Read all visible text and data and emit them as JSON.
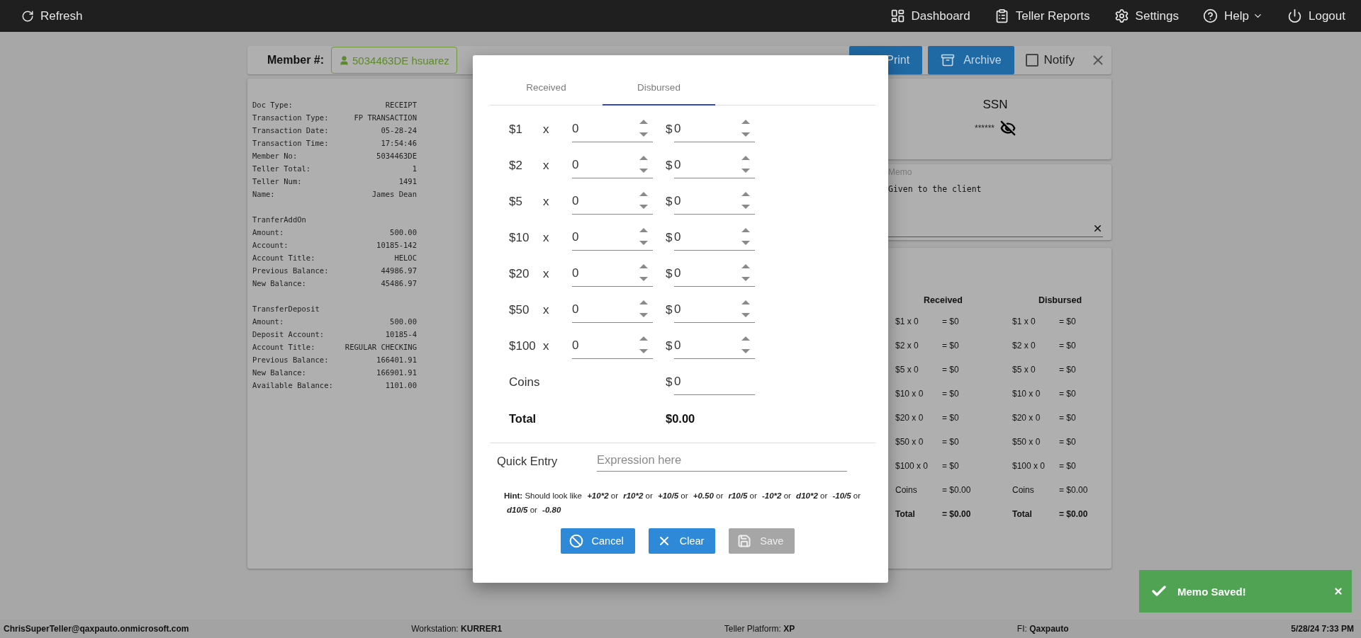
{
  "top_bar": {
    "left": [
      {
        "label": "Refresh"
      }
    ],
    "right": [
      {
        "label": "Dashboard",
        "has_menu": false
      },
      {
        "label": "Teller Reports",
        "has_menu": false
      },
      {
        "label": "Settings",
        "has_menu": false
      },
      {
        "label": "Help",
        "has_menu": true
      },
      {
        "label": "Logout",
        "has_menu": false
      }
    ]
  },
  "member": {
    "label": "Member #:",
    "value": "5034463DE hsuarez"
  },
  "actions": {
    "buttons": [
      {
        "label": "Print"
      },
      {
        "label": "Archive"
      }
    ],
    "notify": {
      "label": "Notify",
      "checked": false
    }
  },
  "receipt": {
    "sections": [
      {
        "lines": [
          {
            "label": "Doc Type:",
            "value": "RECEIPT"
          },
          {
            "label": "Transaction Type:",
            "value": "FP TRANSACTION"
          },
          {
            "label": "Transaction Date:",
            "value": "05-28-24"
          },
          {
            "label": "Transaction Time:",
            "value": "17:54:46"
          },
          {
            "label": "Member No:",
            "value": "5034463DE"
          },
          {
            "label": "Teller Total:",
            "value": "1"
          },
          {
            "label": "Teller Num:",
            "value": "1491"
          },
          {
            "label": "Name:",
            "value": "James Dean"
          }
        ]
      },
      {
        "title": "TranferAddOn",
        "lines": [
          {
            "label": "Amount:",
            "value": "500.00"
          },
          {
            "label": "Account:",
            "value": "10185-142"
          },
          {
            "label": "Account Title:",
            "value": "HELOC"
          },
          {
            "label": "Previous Balance:",
            "value": "44986.97"
          },
          {
            "label": "New Balance:",
            "value": "45486.97"
          }
        ]
      },
      {
        "title": "TransferDeposit",
        "lines": [
          {
            "label": "Amount:",
            "value": "500.00"
          },
          {
            "label": "Deposit Account:",
            "value": "10185-4"
          },
          {
            "label": "Account Title:",
            "value": "REGULAR CHECKING"
          },
          {
            "label": "Previous Balance:",
            "value": "166401.91"
          },
          {
            "label": "New Balance:",
            "value": "166901.91"
          },
          {
            "label": "Available Balance:",
            "value": "1101.00"
          }
        ]
      }
    ]
  },
  "ssn": {
    "title": "SSN",
    "value": "******"
  },
  "memo": {
    "label": "Memo",
    "value": "Given to the client"
  },
  "summary": {
    "columns": [
      {
        "title": "Received",
        "rows": [
          {
            "item": "$1 x 0",
            "total": "= $0",
            "kind": "line"
          },
          {
            "item": "$2 x 0",
            "total": "= $0",
            "kind": "line"
          },
          {
            "item": "$5 x 0",
            "total": "= $0",
            "kind": "line"
          },
          {
            "item": "$10 x 0",
            "total": "= $0",
            "kind": "line"
          },
          {
            "item": "$20 x 0",
            "total": "= $0",
            "kind": "line"
          },
          {
            "item": "$50 x 0",
            "total": "= $0",
            "kind": "line"
          },
          {
            "item": "$100 x 0",
            "total": "= $0",
            "kind": "line"
          },
          {
            "item": "Coins",
            "total": "= $0.00",
            "kind": "line"
          },
          {
            "item": "Total",
            "total": "= $0.00",
            "kind": "total"
          }
        ]
      },
      {
        "title": "Disbursed",
        "rows": [
          {
            "item": "$1 x 0",
            "total": "= $0",
            "kind": "line"
          },
          {
            "item": "$2 x 0",
            "total": "= $0",
            "kind": "line"
          },
          {
            "item": "$5 x 0",
            "total": "= $0",
            "kind": "line"
          },
          {
            "item": "$10 x 0",
            "total": "= $0",
            "kind": "line"
          },
          {
            "item": "$20 x 0",
            "total": "= $0",
            "kind": "line"
          },
          {
            "item": "$50 x 0",
            "total": "= $0",
            "kind": "line"
          },
          {
            "item": "$100 x 0",
            "total": "= $0",
            "kind": "line"
          },
          {
            "item": "Coins",
            "total": "= $0.00",
            "kind": "line"
          },
          {
            "item": "Total",
            "total": "= $0.00",
            "kind": "total"
          }
        ]
      }
    ]
  },
  "modal": {
    "tabs": [
      {
        "label": "Received",
        "selected": false
      },
      {
        "label": "Disbursed",
        "selected": true
      }
    ],
    "rows": [
      {
        "kind": "bill",
        "denomination": "$1",
        "sign": "x",
        "count": "0",
        "currency": "$",
        "amount": "0"
      },
      {
        "kind": "bill",
        "denomination": "$2",
        "sign": "x",
        "count": "0",
        "currency": "$",
        "amount": "0"
      },
      {
        "kind": "bill",
        "denomination": "$5",
        "sign": "x",
        "count": "0",
        "currency": "$",
        "amount": "0"
      },
      {
        "kind": "bill",
        "denomination": "$10",
        "sign": "x",
        "count": "0",
        "currency": "$",
        "amount": "0"
      },
      {
        "kind": "bill",
        "denomination": "$20",
        "sign": "x",
        "count": "0",
        "currency": "$",
        "amount": "0"
      },
      {
        "kind": "bill",
        "denomination": "$50",
        "sign": "x",
        "count": "0",
        "currency": "$",
        "amount": "0"
      },
      {
        "kind": "bill",
        "denomination": "$100",
        "sign": "x",
        "count": "0",
        "currency": "$",
        "amount": "0"
      },
      {
        "kind": "coins",
        "denomination": "Coins",
        "currency": "$",
        "amount": "0"
      }
    ],
    "total": {
      "label": "Total",
      "value": "$0.00"
    },
    "quick_entry": {
      "label": "Quick Entry",
      "placeholder": "Expression here"
    },
    "hint": [
      {
        "kind": "label",
        "text": "Hint:"
      },
      {
        "kind": "plain",
        "text": "Should look like"
      },
      {
        "kind": "example",
        "text": "+10*2"
      },
      {
        "kind": "plain",
        "text": "or"
      },
      {
        "kind": "example",
        "text": "r10*2"
      },
      {
        "kind": "plain",
        "text": "or"
      },
      {
        "kind": "example",
        "text": "+10/5"
      },
      {
        "kind": "plain",
        "text": "or"
      },
      {
        "kind": "example",
        "text": "+0.50"
      },
      {
        "kind": "plain",
        "text": "or"
      },
      {
        "kind": "example",
        "text": "r10/5"
      },
      {
        "kind": "plain",
        "text": "or"
      },
      {
        "kind": "example",
        "text": "-10*2"
      },
      {
        "kind": "plain",
        "text": "or"
      },
      {
        "kind": "example",
        "text": "d10*2"
      },
      {
        "kind": "plain",
        "text": "or"
      },
      {
        "kind": "example",
        "text": "-10/5"
      },
      {
        "kind": "plain",
        "text": "or"
      },
      {
        "kind": "example",
        "text": "d10/5"
      },
      {
        "kind": "plain",
        "text": "or"
      },
      {
        "kind": "example",
        "text": "-0.80"
      }
    ],
    "buttons": [
      {
        "label": "Cancel",
        "disabled": false
      },
      {
        "label": "Clear",
        "disabled": false
      },
      {
        "label": "Save",
        "disabled": true
      }
    ]
  },
  "toast": {
    "message": "Memo Saved!"
  },
  "status_bar": [
    {
      "value": "ChrisSuperTeller@qaxpauto.onmicrosoft.com"
    },
    {
      "label": "Workstation:",
      "value": "KURRER1"
    },
    {
      "label": "Teller Platform:",
      "value": "XP"
    },
    {
      "label": "FI:",
      "value": "Qaxpauto"
    },
    {
      "value": "5/28/24 7:33 PM"
    }
  ]
}
